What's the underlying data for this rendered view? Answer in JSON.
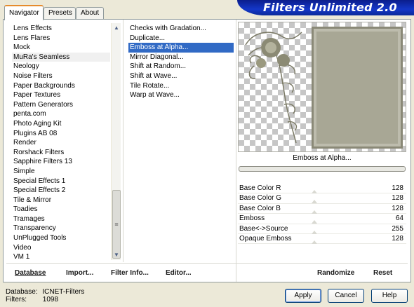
{
  "tabs": [
    {
      "label": "Navigator",
      "active": true
    },
    {
      "label": "Presets",
      "active": false
    },
    {
      "label": "About",
      "active": false
    }
  ],
  "banner": {
    "title": "Filters Unlimited 2.0"
  },
  "categories": [
    "Lens Effects",
    "Lens Flares",
    "Mock",
    "MuRa's Seamless",
    "Neology",
    "Noise Filters",
    "Paper Backgrounds",
    "Paper Textures",
    "Pattern Generators",
    "penta.com",
    "Photo Aging Kit",
    "Plugins AB 08",
    "Render",
    "Rorshack Filters",
    "Sapphire Filters 13",
    "Simple",
    "Special Effects 1",
    "Special Effects 2",
    "Tile & Mirror",
    "Toadies",
    "Tramages",
    "Transparency",
    "UnPlugged Tools",
    "Video",
    "VM 1"
  ],
  "selected_category": "MuRa's Seamless",
  "filters": [
    "Checks with Gradation...",
    "Duplicate...",
    "Emboss at Alpha...",
    "Mirror Diagonal...",
    "Shift at Random...",
    "Shift at Wave...",
    "Tile Rotate...",
    "Warp at Wave..."
  ],
  "selected_filter": "Emboss at Alpha...",
  "preview": {
    "filter_name": "Emboss at Alpha..."
  },
  "params": [
    {
      "name": "Base Color R",
      "value": "128"
    },
    {
      "name": "Base Color G",
      "value": "128"
    },
    {
      "name": "Base Color B",
      "value": "128"
    },
    {
      "name": "Emboss",
      "value": "64"
    },
    {
      "name": "Base<->Source",
      "value": "255"
    },
    {
      "name": "Opaque Emboss",
      "value": "128"
    }
  ],
  "actions": {
    "database": "Database",
    "import": "Import...",
    "filter_info": "Filter Info...",
    "editor": "Editor...",
    "randomize": "Randomize",
    "reset": "Reset"
  },
  "status": {
    "database_label": "Database:",
    "database_value": "ICNET-Filters",
    "filters_label": "Filters:",
    "filters_value": "1098"
  },
  "buttons": {
    "apply": "Apply",
    "cancel": "Cancel",
    "help": "Help"
  },
  "colors": {
    "accent": "#316ac5",
    "banner": "#1437c8",
    "frame": "#a8a795"
  }
}
